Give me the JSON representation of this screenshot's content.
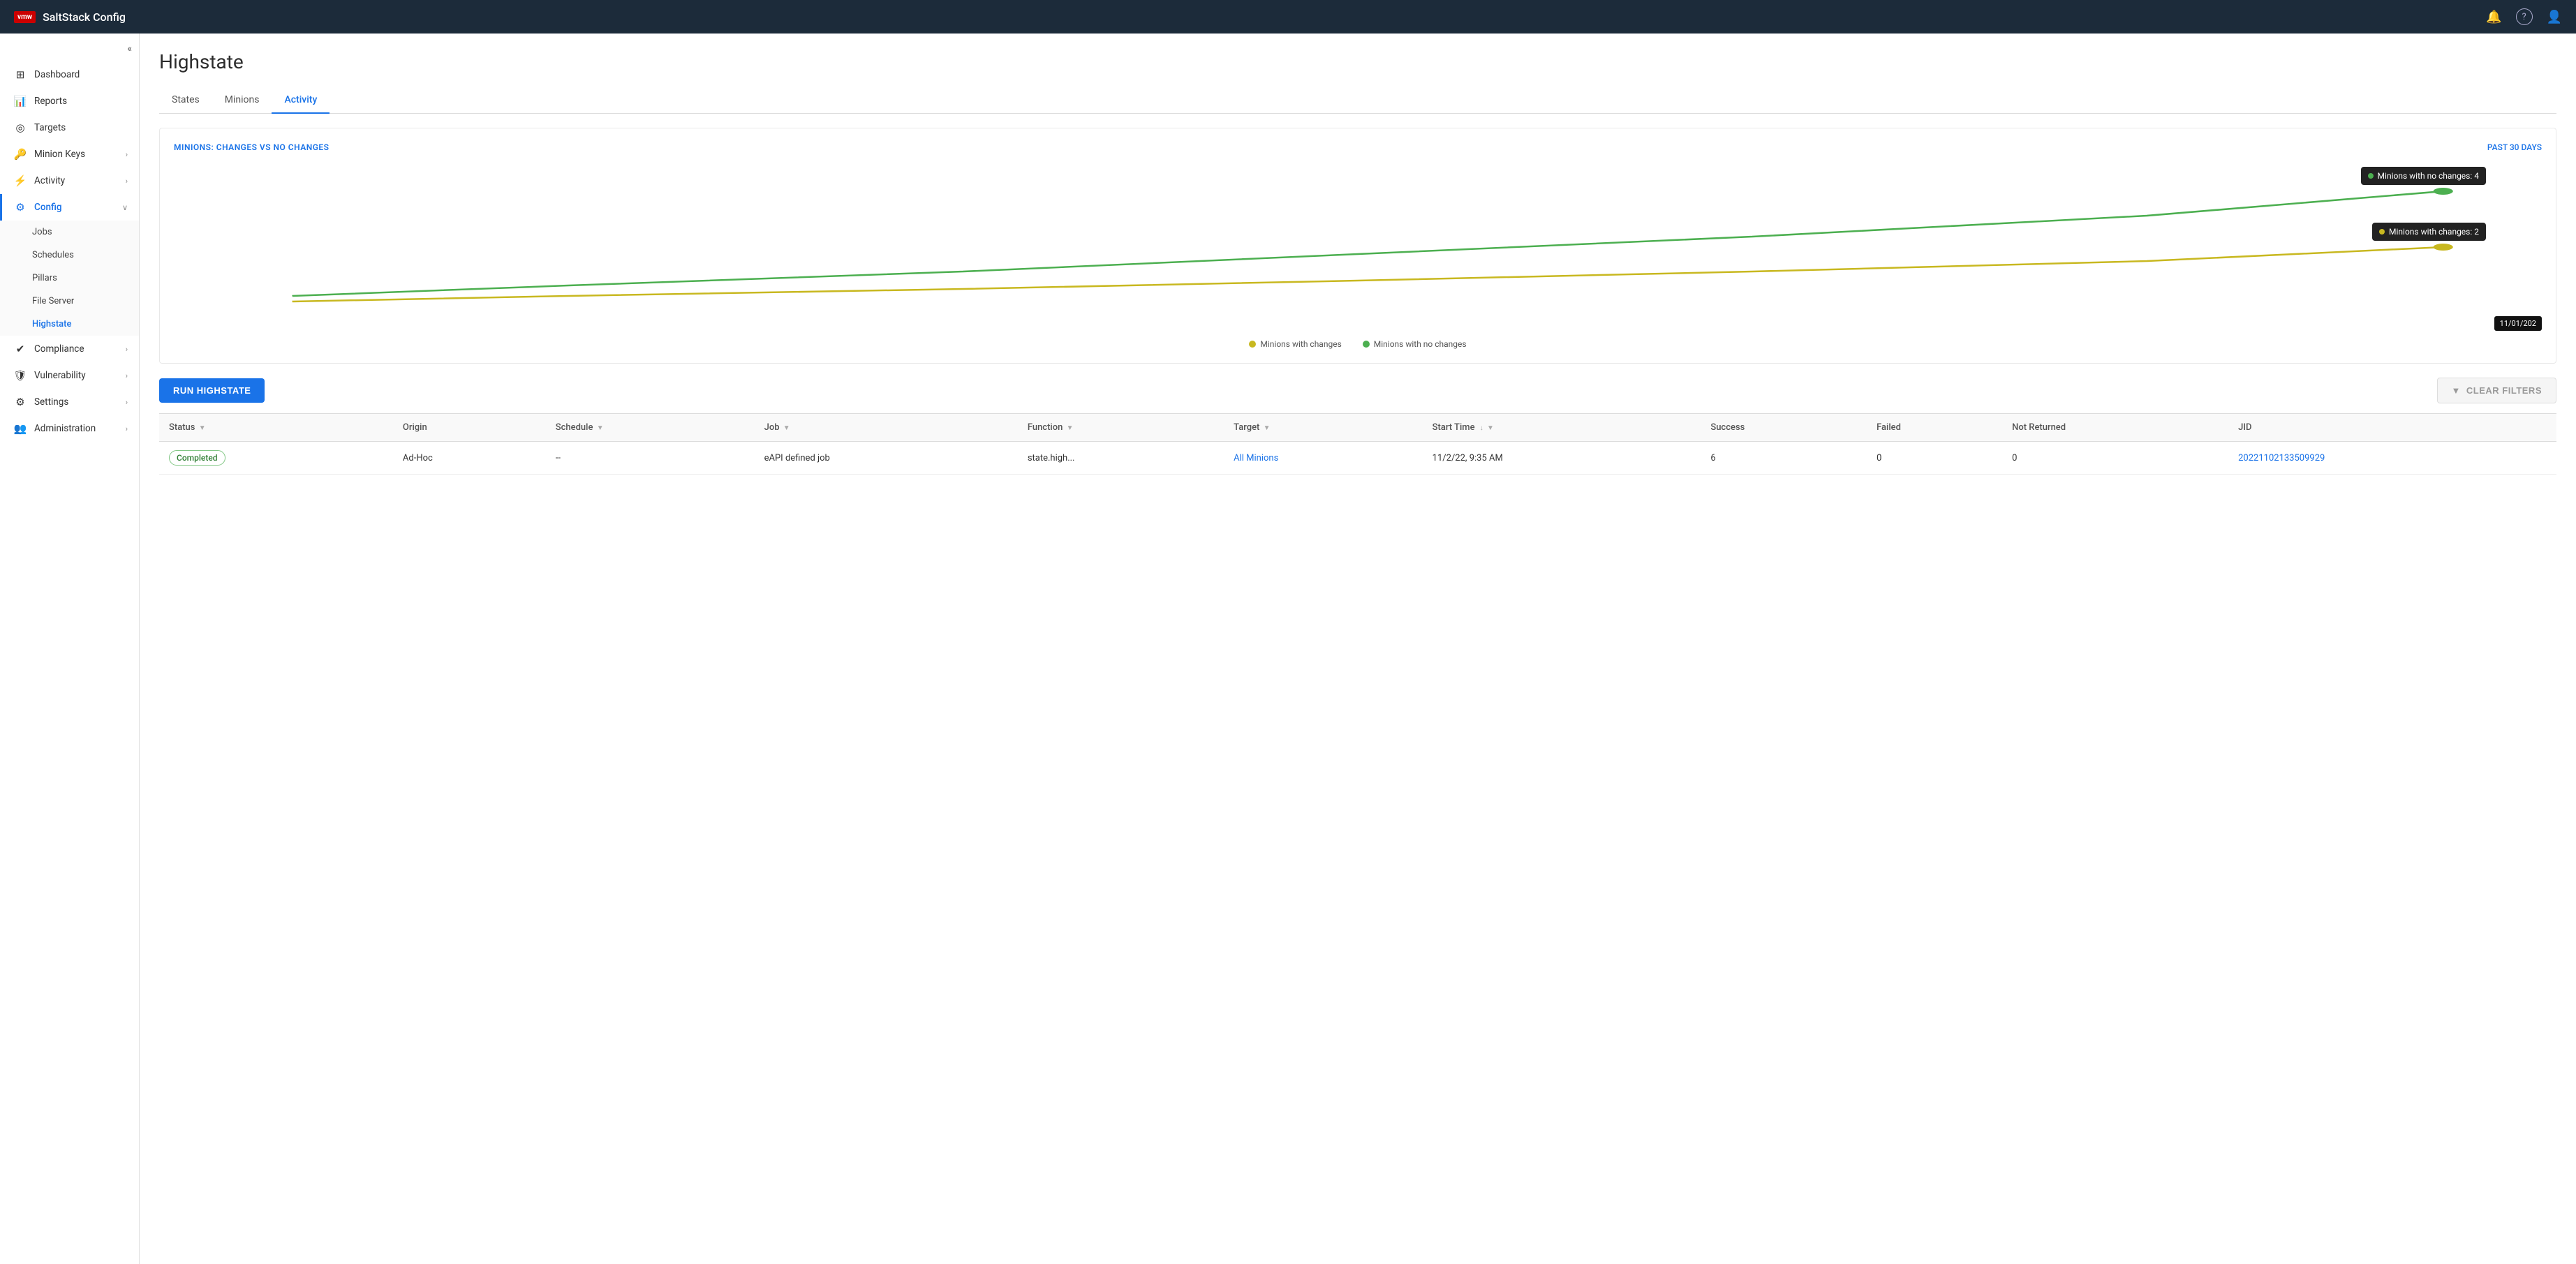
{
  "app": {
    "logo": "vmw",
    "title": "SaltStack Config"
  },
  "topnav": {
    "notification_icon": "🔔",
    "help_icon": "?",
    "user_icon": "👤"
  },
  "sidebar": {
    "collapse_icon": "«",
    "items": [
      {
        "id": "dashboard",
        "label": "Dashboard",
        "icon": "⊞",
        "active": false,
        "hasArrow": false
      },
      {
        "id": "reports",
        "label": "Reports",
        "icon": "📊",
        "active": false,
        "hasArrow": false
      },
      {
        "id": "targets",
        "label": "Targets",
        "icon": "◎",
        "active": false,
        "hasArrow": false
      },
      {
        "id": "minion-keys",
        "label": "Minion Keys",
        "icon": "🔑",
        "active": false,
        "hasArrow": true
      },
      {
        "id": "activity",
        "label": "Activity",
        "icon": "⚙",
        "active": false,
        "hasArrow": true
      },
      {
        "id": "config",
        "label": "Config",
        "icon": "⚙",
        "active": true,
        "hasArrow": true,
        "expanded": true
      },
      {
        "id": "compliance",
        "label": "Compliance",
        "icon": "✔",
        "active": false,
        "hasArrow": true
      },
      {
        "id": "vulnerability",
        "label": "Vulnerability",
        "icon": "🛡",
        "active": false,
        "hasArrow": true
      },
      {
        "id": "settings",
        "label": "Settings",
        "icon": "⚙",
        "active": false,
        "hasArrow": true
      },
      {
        "id": "administration",
        "label": "Administration",
        "icon": "👥",
        "active": false,
        "hasArrow": true
      }
    ],
    "config_subitems": [
      {
        "id": "jobs",
        "label": "Jobs",
        "active": false
      },
      {
        "id": "schedules",
        "label": "Schedules",
        "active": false
      },
      {
        "id": "pillars",
        "label": "Pillars",
        "active": false
      },
      {
        "id": "file-server",
        "label": "File Server",
        "active": false
      },
      {
        "id": "highstate",
        "label": "Highstate",
        "active": true
      }
    ]
  },
  "page": {
    "title": "Highstate"
  },
  "tabs": [
    {
      "id": "states",
      "label": "States",
      "active": false
    },
    {
      "id": "minions",
      "label": "Minions",
      "active": false
    },
    {
      "id": "activity",
      "label": "Activity",
      "active": true
    }
  ],
  "chart": {
    "title": "MINIONS: CHANGES VS NO CHANGES",
    "period": "PAST 30 DAYS",
    "tooltip_no_changes": "Minions with no changes: 4",
    "tooltip_changes": "Minions with changes: 2",
    "date_tooltip": "11/01/202",
    "legend": [
      {
        "id": "changes",
        "label": "Minions with changes",
        "color": "#c8b820"
      },
      {
        "id": "no-changes",
        "label": "Minions with no changes",
        "color": "#4caf50"
      }
    ]
  },
  "actions": {
    "run_highstate": "RUN HIGHSTATE",
    "clear_filters": "CLEAR FILTERS"
  },
  "table": {
    "columns": [
      {
        "id": "status",
        "label": "Status",
        "filterable": true,
        "sortable": false
      },
      {
        "id": "origin",
        "label": "Origin",
        "filterable": false,
        "sortable": false
      },
      {
        "id": "schedule",
        "label": "Schedule",
        "filterable": true,
        "sortable": false
      },
      {
        "id": "job",
        "label": "Job",
        "filterable": true,
        "sortable": false
      },
      {
        "id": "function",
        "label": "Function",
        "filterable": true,
        "sortable": false
      },
      {
        "id": "target",
        "label": "Target",
        "filterable": true,
        "sortable": false
      },
      {
        "id": "start-time",
        "label": "Start Time",
        "filterable": true,
        "sortable": true
      },
      {
        "id": "success",
        "label": "Success",
        "filterable": false,
        "sortable": false
      },
      {
        "id": "failed",
        "label": "Failed",
        "filterable": false,
        "sortable": false
      },
      {
        "id": "not-returned",
        "label": "Not Returned",
        "filterable": false,
        "sortable": false
      },
      {
        "id": "jid",
        "label": "JID",
        "filterable": false,
        "sortable": false
      }
    ],
    "rows": [
      {
        "status": "Completed",
        "status_type": "completed",
        "origin": "Ad-Hoc",
        "schedule": "--",
        "job": "eAPI defined job",
        "function": "state.high...",
        "target": "All Minions",
        "target_link": true,
        "start_time": "11/2/22, 9:35 AM",
        "success": "6",
        "failed": "0",
        "not_returned": "0",
        "jid": "20221102133509929",
        "jid_link": true
      }
    ]
  }
}
